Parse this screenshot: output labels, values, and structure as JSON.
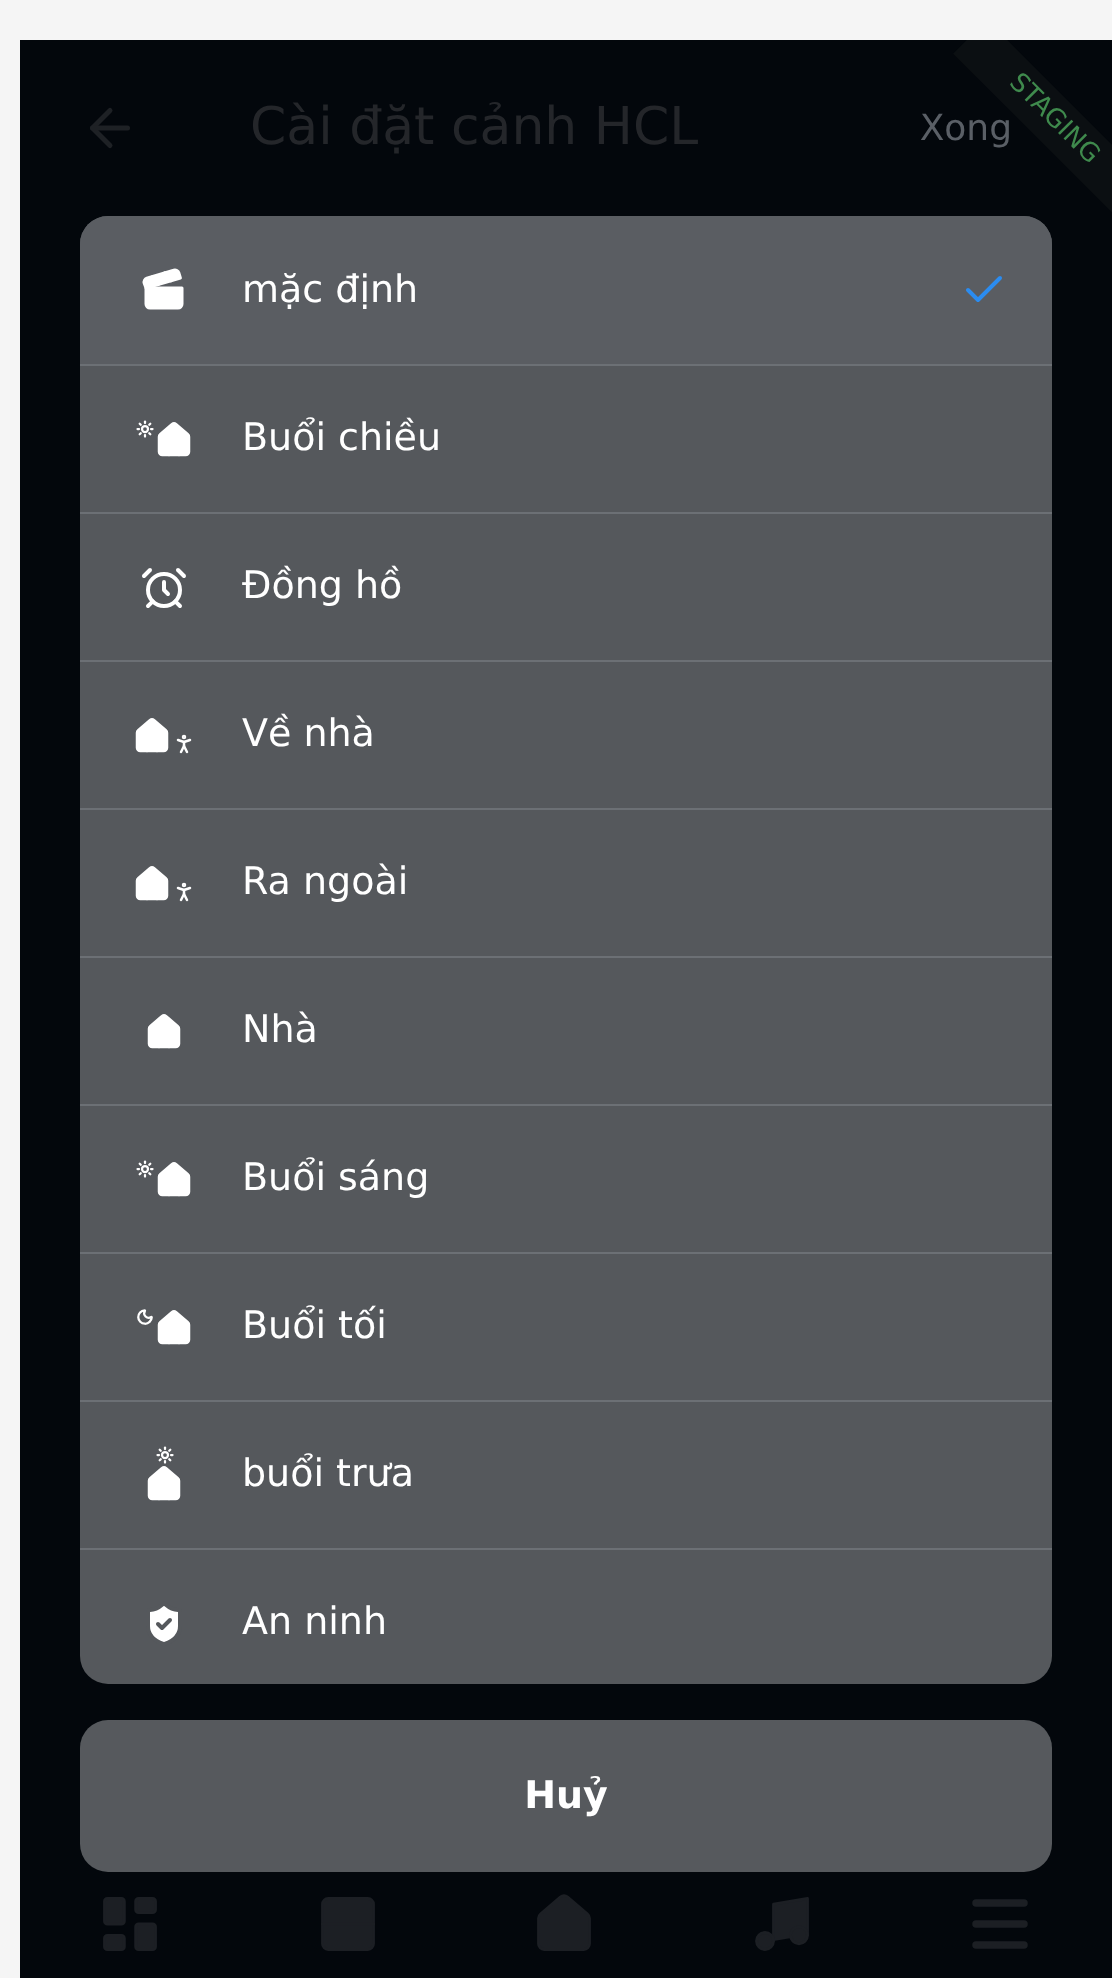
{
  "header": {
    "title": "Cài đặt cảnh HCL",
    "action": "Xong",
    "ribbon": "STAGING"
  },
  "scene_picker": {
    "items": [
      {
        "kind": "scene",
        "label": "mặc định",
        "selected": true
      },
      {
        "kind": "afternoon",
        "label": "Buổi chiều",
        "selected": false
      },
      {
        "kind": "clock",
        "label": "Đồng hồ",
        "selected": false
      },
      {
        "kind": "arrive",
        "label": "Về nhà",
        "selected": false
      },
      {
        "kind": "leave",
        "label": "Ra ngoài",
        "selected": false
      },
      {
        "kind": "home",
        "label": "Nhà",
        "selected": false
      },
      {
        "kind": "morning",
        "label": "Buổi sáng",
        "selected": false
      },
      {
        "kind": "evening",
        "label": "Buổi tối",
        "selected": false
      },
      {
        "kind": "noon",
        "label": "buổi trưa",
        "selected": false
      },
      {
        "kind": "security",
        "label": "An ninh",
        "selected": false
      }
    ],
    "cancel": "Huỷ"
  },
  "bottom_nav": [
    {
      "kind": "dashboard"
    },
    {
      "kind": "rooms"
    },
    {
      "kind": "home"
    },
    {
      "kind": "music"
    },
    {
      "kind": "menu"
    }
  ]
}
